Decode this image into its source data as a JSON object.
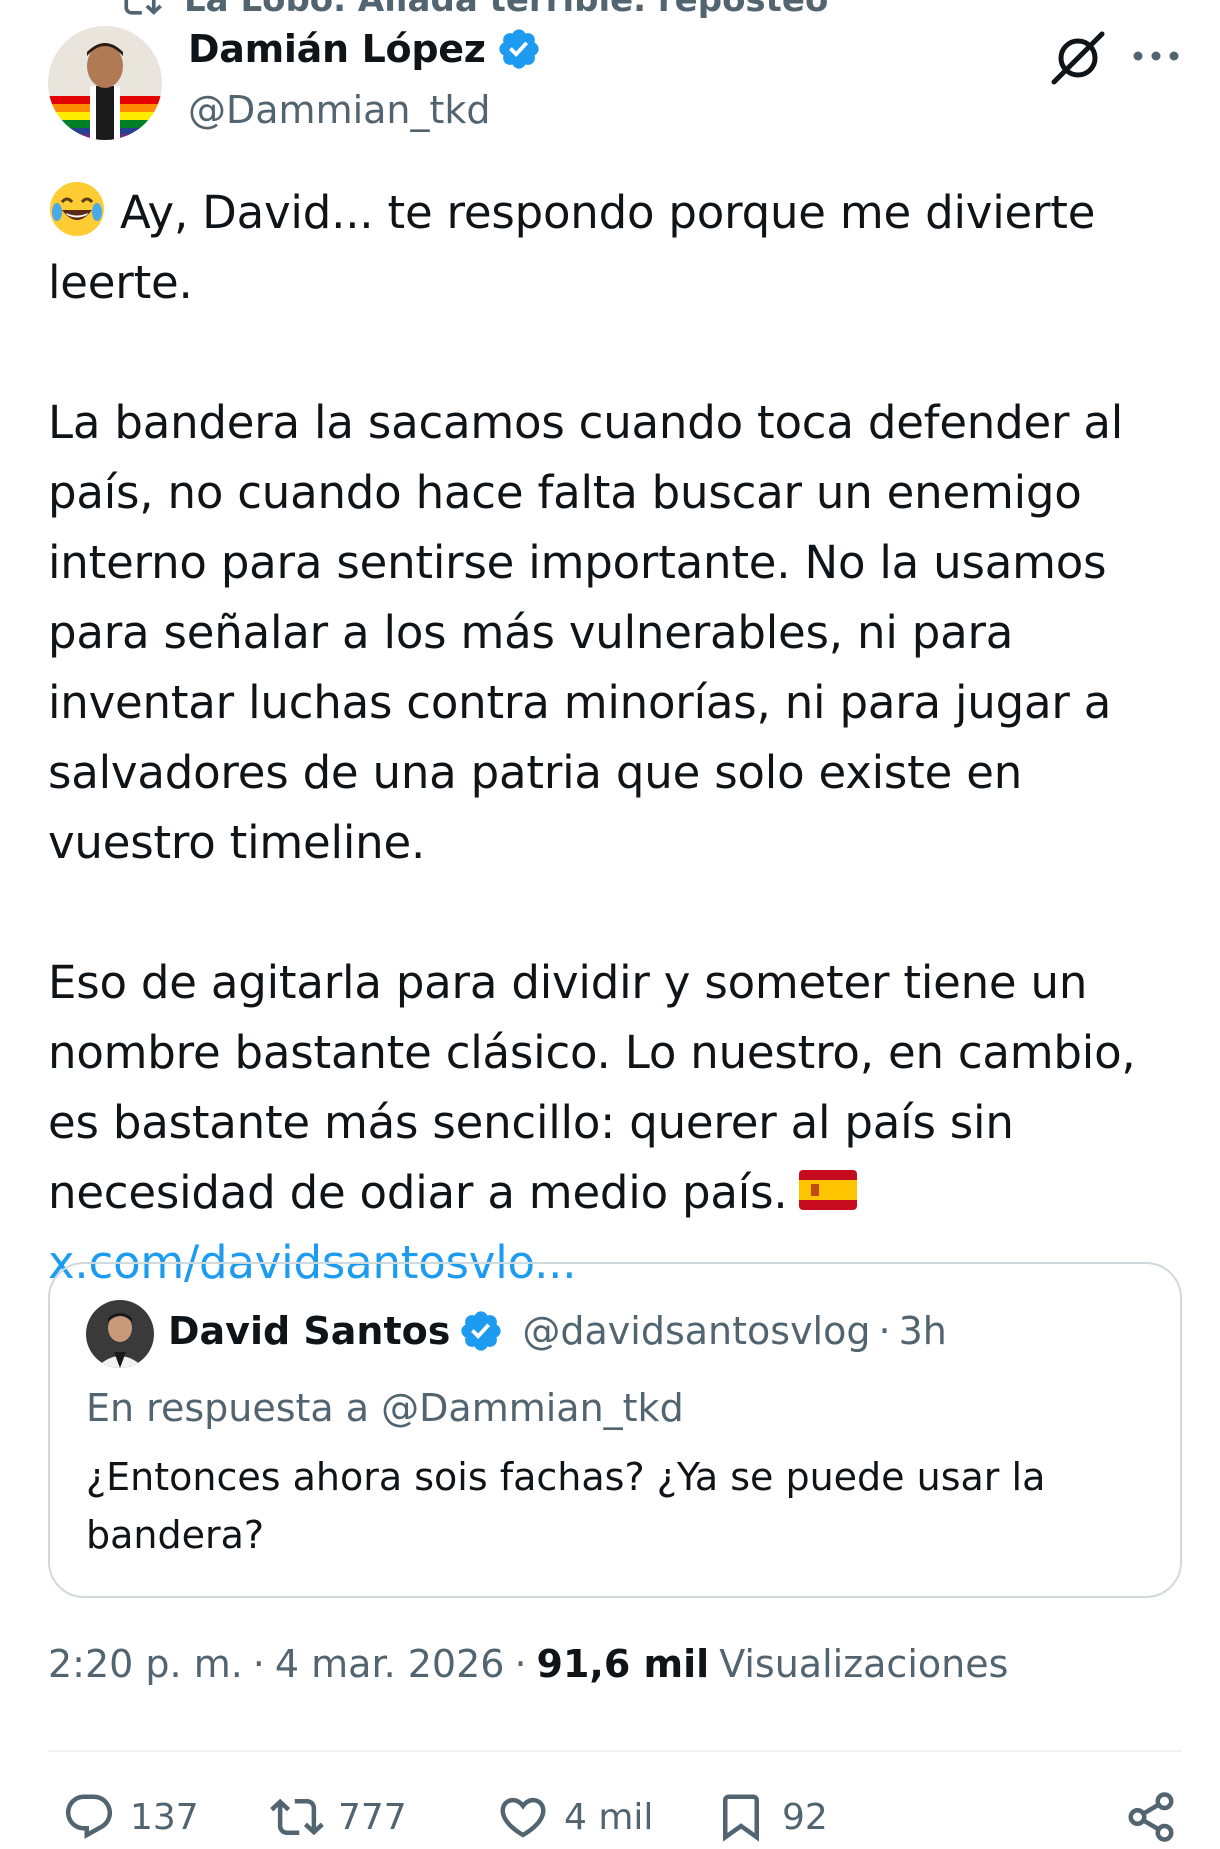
{
  "repost_header": {
    "text": "La Lobo. Aliada terrible. reposteó"
  },
  "author": {
    "name": "Damián López",
    "handle": "@Dammian_tkd",
    "verified": true
  },
  "tweet": {
    "paragraph1": "Ay, David... te respondo porque me divierte leerte.",
    "paragraph2": "La bandera la sacamos cuando toca defender al país, no cuando hace falta buscar un enemigo interno para sentirse importante. No la usamos para señalar a los más vulnerables, ni para inventar luchas contra minorías, ni para jugar a salvadores de una patria que solo existe en vuestro timeline.",
    "paragraph3": "Eso de agitarla para dividir y someter tiene un nombre bastante clásico. Lo nuestro, en cambio, es bastante más sencillo: querer al país sin necesidad de odiar a medio país.",
    "link": "x.com/davidsantosvlo..."
  },
  "quoted": {
    "name": "David Santos",
    "handle": "@davidsantosvlog",
    "separator": "·",
    "time": "3h",
    "reply_to": "En respuesta a @Dammian_tkd",
    "text": "¿Entonces ahora sois fachas? ¿Ya se puede usar la bandera?"
  },
  "meta": {
    "time": "2:20 p. m.",
    "separator1": "·",
    "date": "4 mar. 2026",
    "separator2": "·",
    "views_count": "91,6 mil",
    "views_label": "Visualizaciones"
  },
  "actions": {
    "replies": "137",
    "reposts": "777",
    "likes": "4 mil",
    "bookmarks": "92"
  },
  "colors": {
    "text": "#0f1419",
    "secondary": "#536471",
    "link": "#1d9bf0",
    "border": "#cfd9de",
    "verified": "#1d9bf0"
  },
  "icons": {
    "repost_header": "repost-icon",
    "verified": "verified-badge-icon",
    "grok": "grok-icon",
    "more": "more-icon",
    "reply": "reply-icon",
    "repost": "repost-icon",
    "like": "heart-icon",
    "bookmark": "bookmark-icon",
    "share": "share-icon",
    "emoji": "joy-emoji-icon",
    "flag": "spain-flag-icon"
  }
}
